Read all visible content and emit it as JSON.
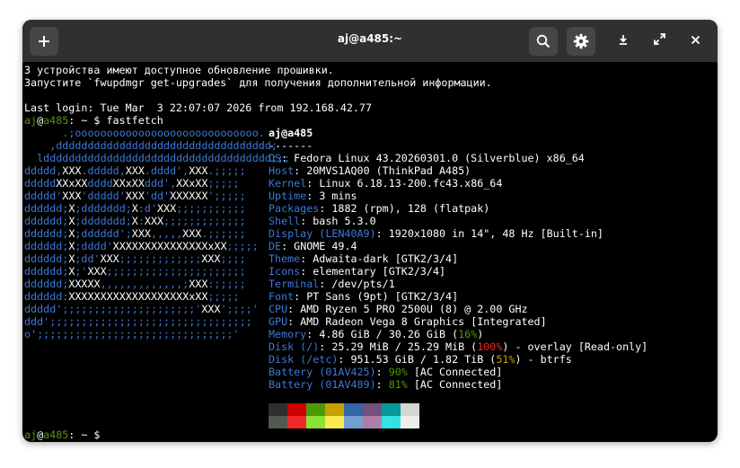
{
  "window": {
    "title": "aj@a485:~"
  },
  "header": {
    "new_tab_icon": "plus-icon",
    "search_icon": "search-icon",
    "menu_icon": "gear-icon",
    "minimize_icon": "minimize-icon",
    "maximize_icon": "maximize-icon",
    "close_icon": "close-icon"
  },
  "terminal": {
    "preamble": [
      "3 устройства имеют доступное обновление прошивки.",
      "Запустите `fwupdmgr get-upgrades` для получения дополнительной информации.",
      "",
      "Last login: Tue Mar  3 22:07:07 2026 from 192.168.42.77"
    ],
    "prompt": {
      "user": "aj",
      "at": "@",
      "host": "a485",
      "path": ": ~ $ ",
      "command": "fastfetch"
    },
    "logo_lines": [
      "      .;ooooooooooooooooooooooooooooo.",
      "    ,dddddddddddddddddddddddddddddddddd;",
      "  ldddddddddddddddddddddddddddddddddddd;;;",
      "ddddd,XXX.ddddd,XXX.dddd',XXX.;;;;;",
      "dddddXX%XXddddXX%XXddd',XX%XX;;;;;",
      "ddddd'XXX'ddddd'XXX'dd'XXXXXX';;;;;",
      "dddddd;X;ddddddd;X:d'XXX;;;;;;;;;;;",
      "dddddd;X;ddddddd;X:XXX;;;;;;;;;;;;;",
      "dddddd;X;dddddd';XXX,,,,,XXX.;;;;;;",
      "dddddd;X;dddd'XXXXXXXXXXXXXXX%XX;;;;;",
      "dddddd;X;dd'XXX;;;;;;;;;;;;;XXX;;;;",
      "dddddd;X;'XXX;;;;;;;;;;;;;;;;;;;;;;",
      "dddddd;XXXXX,,,,,,,,,,,,,;XXX:;;;;;",
      "dddddd:XXXXXXXXXXXXXXXXXXX%XX;;;;;",
      "ddddd';;;;;;;;;;;;;;;;;;;;;'XXX';;;;'",
      "ddd';;;;;;;;;;;;;;;;;;;;;;;;;;;;;;;;",
      "o';;;;;;;;;;;;;;;;;;;;;;;;;;;;;;;'"
    ],
    "info": {
      "user_host": "aj@a485",
      "separator": "-------",
      "rows": [
        {
          "key": "OS",
          "value": "Fedora Linux 43.20260301.0 (Silverblue) x86_64"
        },
        {
          "key": "Host",
          "value": "20MVS1AQ00 (ThinkPad A485)"
        },
        {
          "key": "Kernel",
          "value": "Linux 6.18.13-200.fc43.x86_64"
        },
        {
          "key": "Uptime",
          "value": "3 mins"
        },
        {
          "key": "Packages",
          "value": "1882 (rpm), 128 (flatpak)"
        },
        {
          "key": "Shell",
          "value": "bash 5.3.0"
        },
        {
          "key": "Display (LEN40A9)",
          "value": "1920x1080 in 14\", 48 Hz [Built-in]"
        },
        {
          "key": "DE",
          "value": "GNOME 49.4"
        },
        {
          "key": "Theme",
          "value": "Adwaita-dark [GTK2/3/4]"
        },
        {
          "key": "Icons",
          "value": "elementary [GTK2/3/4]"
        },
        {
          "key": "Terminal",
          "value": "/dev/pts/1"
        },
        {
          "key": "Font",
          "value": "PT Sans (9pt) [GTK2/3/4]"
        },
        {
          "key": "CPU",
          "value": "AMD Ryzen 5 PRO 2500U (8) @ 2.00 GHz"
        },
        {
          "key": "GPU",
          "value": "AMD Radeon Vega 8 Graphics [Integrated]"
        }
      ],
      "memory": {
        "key": "Memory",
        "pre": "4.86 GiB / 30.26 GiB (",
        "pct": "16%",
        "post": ")"
      },
      "disk_root": {
        "key": "Disk (/)",
        "pre": "25.29 MiB / 25.29 MiB (",
        "pct": "100%",
        "post": ") - overlay [Read-only]"
      },
      "disk_etc": {
        "key": "Disk (/etc)",
        "pre": "951.53 GiB / 1.82 TiB (",
        "pct": "51%",
        "post": ") - btrfs"
      },
      "battery1": {
        "key": "Battery (01AV425)",
        "pct": "90%",
        "post": " [AC Connected]"
      },
      "battery2": {
        "key": "Battery (01AV489)",
        "pct": "81%",
        "post": " [AC Connected]"
      },
      "colon": ": "
    },
    "palette_top": [
      "#2e2e2e",
      "#cc0000",
      "#4e9a06",
      "#c4a000",
      "#3465a4",
      "#75507b",
      "#06989a",
      "#d3d7cf"
    ],
    "palette_bottom": [
      "#555753",
      "#ef2929",
      "#8ae234",
      "#fce94f",
      "#729fcf",
      "#ad7fa8",
      "#34e2e2",
      "#eeeeec"
    ],
    "final_prompt": {
      "user": "aj",
      "at": "@",
      "host": "a485",
      "path": ": ~ $"
    }
  },
  "colors": {
    "accent_blue": "#3c78d8",
    "prompt_green": "#4e9a06",
    "red": "#ef2929",
    "yellow": "#c4a000"
  }
}
